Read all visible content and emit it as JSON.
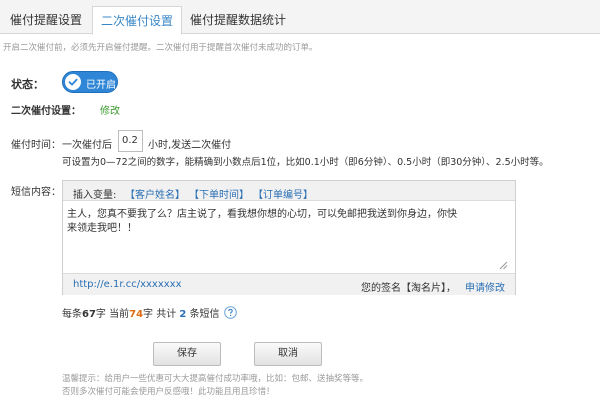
{
  "tabs": [
    {
      "label": "催付提醒设置",
      "active": false
    },
    {
      "label": "二次催付设置",
      "active": true
    },
    {
      "label": "催付提醒数据统计",
      "active": false
    }
  ],
  "notice": "开启二次催付前，必须先开启催付提醒。二次催付用于提醒首次催付未成功的订单。",
  "status": {
    "label": "状态：",
    "toggle_text": "已开启",
    "enabled": true
  },
  "second_setting": {
    "label": "二次催付设置：",
    "edit": "修改"
  },
  "remind_time": {
    "label": "催付时间：",
    "prefix": "一次催付后",
    "value": "0.2",
    "suffix": "小时,发送二次催付",
    "hint": "可设置为0—72之间的数字，能精确到小数点后1位，比如0.1小时（即6分钟）、0.5小时（即30分钟）、2.5小时等。"
  },
  "sms": {
    "label": "短信内容：",
    "insert_label": "插入变量:",
    "variables": [
      "【客户姓名】",
      "【下单时间】",
      "【订单编号】"
    ],
    "content": "主人，您真不要我了么？店主说了，看我想你想的心切，可以免邮把我送到你身边，你快\n来领走我吧！！",
    "short_url": "http://e.1r.cc/xxxxxxx",
    "signature": "您的签名【淘名片】，",
    "apply": "申请修改"
  },
  "counter": {
    "per_label": "每条",
    "per_value": "67",
    "char_unit": "字",
    "current_label": "当前",
    "current_value": "74",
    "total_label": "共计",
    "total_value": "2",
    "total_unit": "条短信"
  },
  "buttons": {
    "save": "保存",
    "cancel": "取消"
  },
  "tips": [
    "温馨提示：给用户一些优惠可大大提高催付成功率哦，比如：包邮、送抽奖等等。",
    "否则多次催付可能会使用户反感哦！此功能且用且珍惜！"
  ],
  "colors": {
    "accent": "#2f86d6",
    "link": "#2a6fb4",
    "edit": "#3b9a2e",
    "highlight": "#e06b12"
  }
}
